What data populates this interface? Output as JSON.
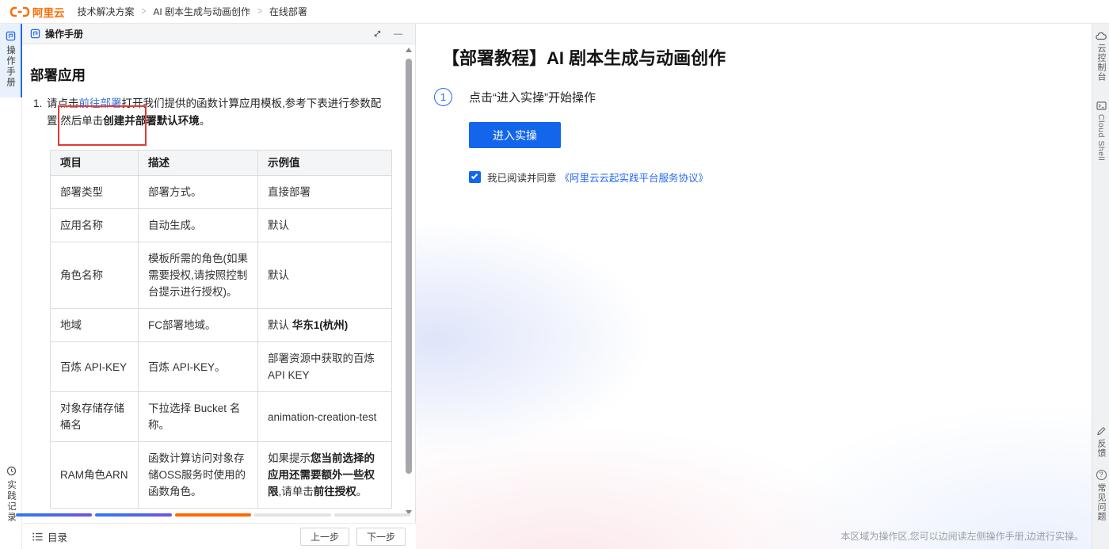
{
  "colors": {
    "brand_orange": "#ff6a00",
    "accent_blue": "#1366ec",
    "link_blue": "#3671d9",
    "annotation_red": "#e23a30",
    "progress_done_start": "#3178f6",
    "progress_done_end": "#6c55e5",
    "progress_current": "#ff6a00",
    "progress_todo": "#e3e3e6"
  },
  "topbar": {
    "logo_text": "阿里云",
    "separator": ">",
    "breadcrumb": [
      "技术解决方案",
      "AI 剧本生成与动画创作",
      "在线部署"
    ]
  },
  "left_rail": {
    "manual": "操作手册",
    "records": "实践记录"
  },
  "manual_panel": {
    "header_title": "操作手册",
    "minimize_glyph": "—",
    "section_title": "部署应用",
    "instruction": {
      "marker": "1.",
      "pre": "请点击",
      "link": "前往部署",
      "after_link": "打开我们提供的函数计算应用模板,参考下表进行参数配",
      "line2": "置,然后单击",
      "bold": "创建并部署默认环境",
      "period": "。"
    },
    "table": {
      "headers": [
        "项目",
        "描述",
        "示例值"
      ],
      "rows": [
        {
          "item": "部署类型",
          "desc": "部署方式。",
          "example": "直接部署"
        },
        {
          "item": "应用名称",
          "desc": "自动生成。",
          "example": "默认"
        },
        {
          "item": "角色名称",
          "desc": "模板所需的角色(如果需要授权,请按照控制台提示进行授权)。",
          "example": "默认"
        },
        {
          "item": "地域",
          "desc": "FC部署地域。",
          "example_prefix": "默认 ",
          "example_bold": "华东1(杭州)"
        },
        {
          "item": "百炼 API-KEY",
          "desc": "百炼 API-KEY。",
          "example": "部署资源中获取的百炼 API KEY"
        },
        {
          "item": "对象存储存储桶名",
          "desc": "下拉选择 Bucket 名称。",
          "example": "animation-creation-test"
        },
        {
          "item": "RAM角色ARN",
          "desc": "函数计算访问对象存储OSS服务时使用的函数角色。",
          "example_p1": "如果提示",
          "example_b1": "您当前选择的应用还需要额外一些权限",
          "example_p2": ",请单击",
          "example_b2": "前往授权",
          "example_p3": "。"
        }
      ]
    },
    "progress": {
      "segments": [
        "done",
        "done",
        "current",
        "todo",
        "todo"
      ]
    },
    "footer": {
      "toc": "目录",
      "prev": "上一步",
      "next": "下一步"
    }
  },
  "workspace": {
    "title": "【部署教程】AI 剧本生成与动画创作",
    "step_number": "1",
    "step_text": "点击“进入实操”开始操作",
    "cta": "进入实操",
    "agreement_text": "我已阅读并同意",
    "agreement_link": "《阿里云云起实践平台服务协议》",
    "hint": "本区域为操作区,您可以边阅读左侧操作手册,边进行实操。"
  },
  "right_rail": {
    "console": "云控制台",
    "cloud_shell": "Cloud Shell",
    "feedback": "反馈",
    "faq": "常见问题"
  }
}
